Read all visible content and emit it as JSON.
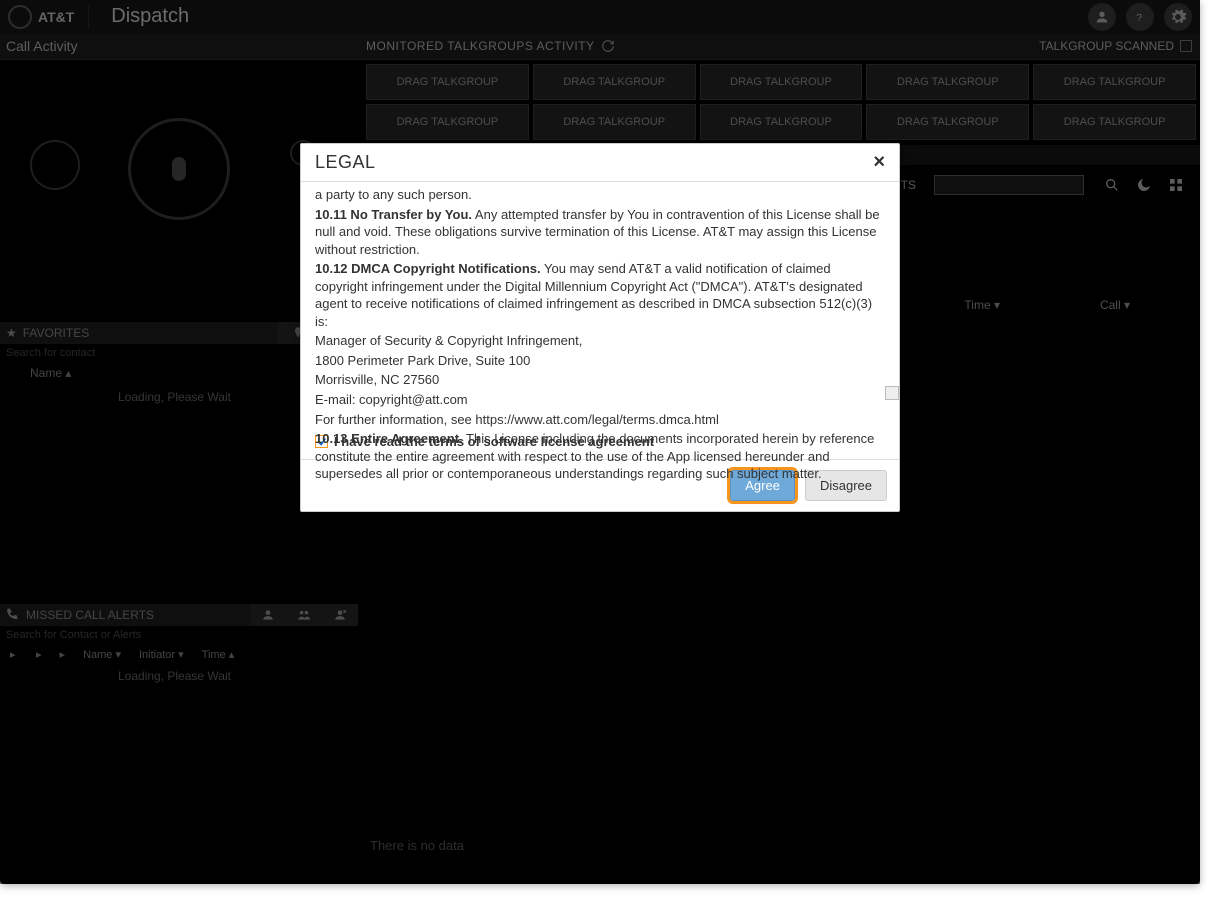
{
  "header": {
    "brand": "AT&T",
    "app_title": "Dispatch"
  },
  "subheader": {
    "call_activity": "Call Activity",
    "monitored": "MONITORED TALKGROUPS ACTIVITY",
    "scanner": "TALKGROUP SCANNED"
  },
  "talkgroups": {
    "rows": [
      [
        "DRAG TALKGROUP",
        "DRAG TALKGROUP",
        "DRAG TALKGROUP",
        "DRAG TALKGROUP",
        "DRAG TALKGROUP"
      ],
      [
        "DRAG TALKGROUP",
        "DRAG TALKGROUP",
        "DRAG TALKGROUP",
        "DRAG TALKGROUP",
        "DRAG TALKGROUP"
      ]
    ]
  },
  "contacts": {
    "panel_title": "CONTACTS",
    "col_time": "Time ▾",
    "col_call": "Call ▾"
  },
  "favorites": {
    "title": "FAVORITES",
    "search_placeholder": "Search for contact",
    "name_col": "Name ▴",
    "loading": "Loading, Please Wait"
  },
  "missed": {
    "title": "MISSED CALL ALERTS",
    "search_placeholder": "Search for Contact or Alerts",
    "cols": {
      "a": "▸",
      "b": "▸",
      "c": "▸",
      "name": "Name ▾",
      "initiator": "Initiator ▾",
      "time": "Time ▴"
    },
    "loading": "Loading, Please Wait"
  },
  "footer": {
    "no_data": "There is no data"
  },
  "modal": {
    "title": "LEGAL",
    "body": {
      "leading_fragment": "a party to any such person.",
      "c11_title": "10.11 No Transfer by You.",
      "c11_body": " Any attempted transfer by You in contravention of this License shall be null and void. These obligations survive termination of this License. AT&T may assign this License without restriction.",
      "c12_title": "10.12 DMCA Copyright Notifications.",
      "c12_body": " You may send AT&T a valid notification of claimed copyright infringement under the Digital Millennium Copyright Act (\"DMCA\"). AT&T's designated agent to receive notifications of claimed infringement as described in DMCA subsection 512(c)(3) is:",
      "addr_line1": "Manager of Security & Copyright Infringement,",
      "addr_line2": "1800 Perimeter Park Drive, Suite 100",
      "addr_line3": "Morrisville, NC 27560",
      "addr_line4": "E-mail: copyright@att.com",
      "addr_line5": "For further information, see https://www.att.com/legal/terms.dmca.html",
      "c13_title": "10.13 Entire Agreement.",
      "c13_body": " This License including the documents incorporated herein by reference constitute the entire agreement with respect to the use of the App licensed hereunder and supersedes all prior or contemporaneous understandings regarding such subject matter."
    },
    "checkbox_label": "I have read the terms of software license agreement",
    "checkbox_checked": true,
    "agree": "Agree",
    "disagree": "Disagree"
  }
}
